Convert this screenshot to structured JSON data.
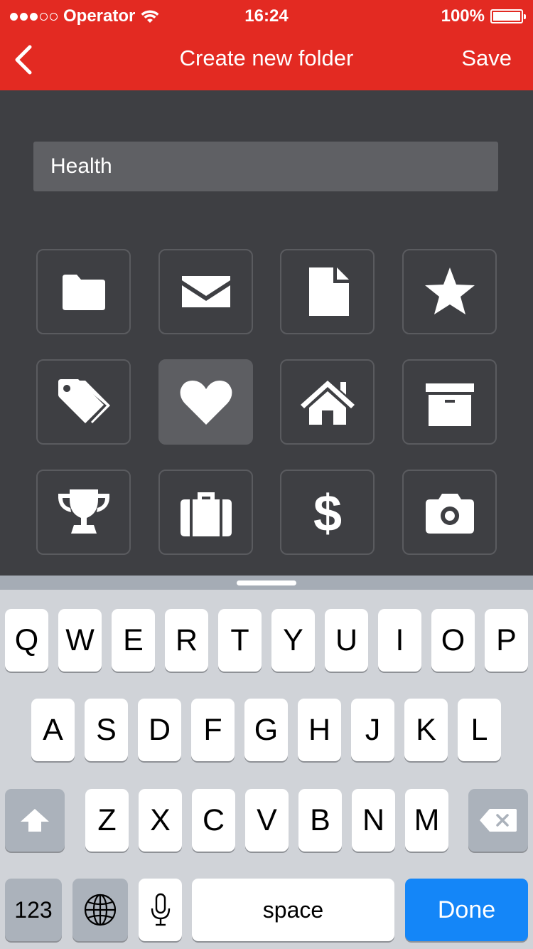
{
  "status_bar": {
    "carrier": "Operator",
    "time": "16:24",
    "battery": "100%"
  },
  "nav": {
    "title": "Create new folder",
    "save_label": "Save",
    "back_icon": "chevron-left-icon"
  },
  "folder_name": {
    "value": "Health"
  },
  "icons": [
    {
      "name": "folder-icon",
      "selected": false
    },
    {
      "name": "envelope-icon",
      "selected": false
    },
    {
      "name": "document-icon",
      "selected": false
    },
    {
      "name": "star-icon",
      "selected": false
    },
    {
      "name": "tags-icon",
      "selected": false
    },
    {
      "name": "heart-icon",
      "selected": true
    },
    {
      "name": "home-icon",
      "selected": false
    },
    {
      "name": "archive-box-icon",
      "selected": false
    },
    {
      "name": "trophy-icon",
      "selected": false
    },
    {
      "name": "briefcase-icon",
      "selected": false
    },
    {
      "name": "dollar-icon",
      "selected": false
    },
    {
      "name": "camera-icon",
      "selected": false
    }
  ],
  "keyboard": {
    "row1": [
      "Q",
      "W",
      "E",
      "R",
      "T",
      "Y",
      "U",
      "I",
      "O",
      "P"
    ],
    "row2": [
      "A",
      "S",
      "D",
      "F",
      "G",
      "H",
      "J",
      "K",
      "L"
    ],
    "row3": [
      "Z",
      "X",
      "C",
      "V",
      "B",
      "N",
      "M"
    ],
    "numbers_label": "123",
    "space_label": "space",
    "done_label": "Done"
  },
  "colors": {
    "header": "#e32a22",
    "background": "#3e3f43",
    "done_key": "#1486f8"
  }
}
